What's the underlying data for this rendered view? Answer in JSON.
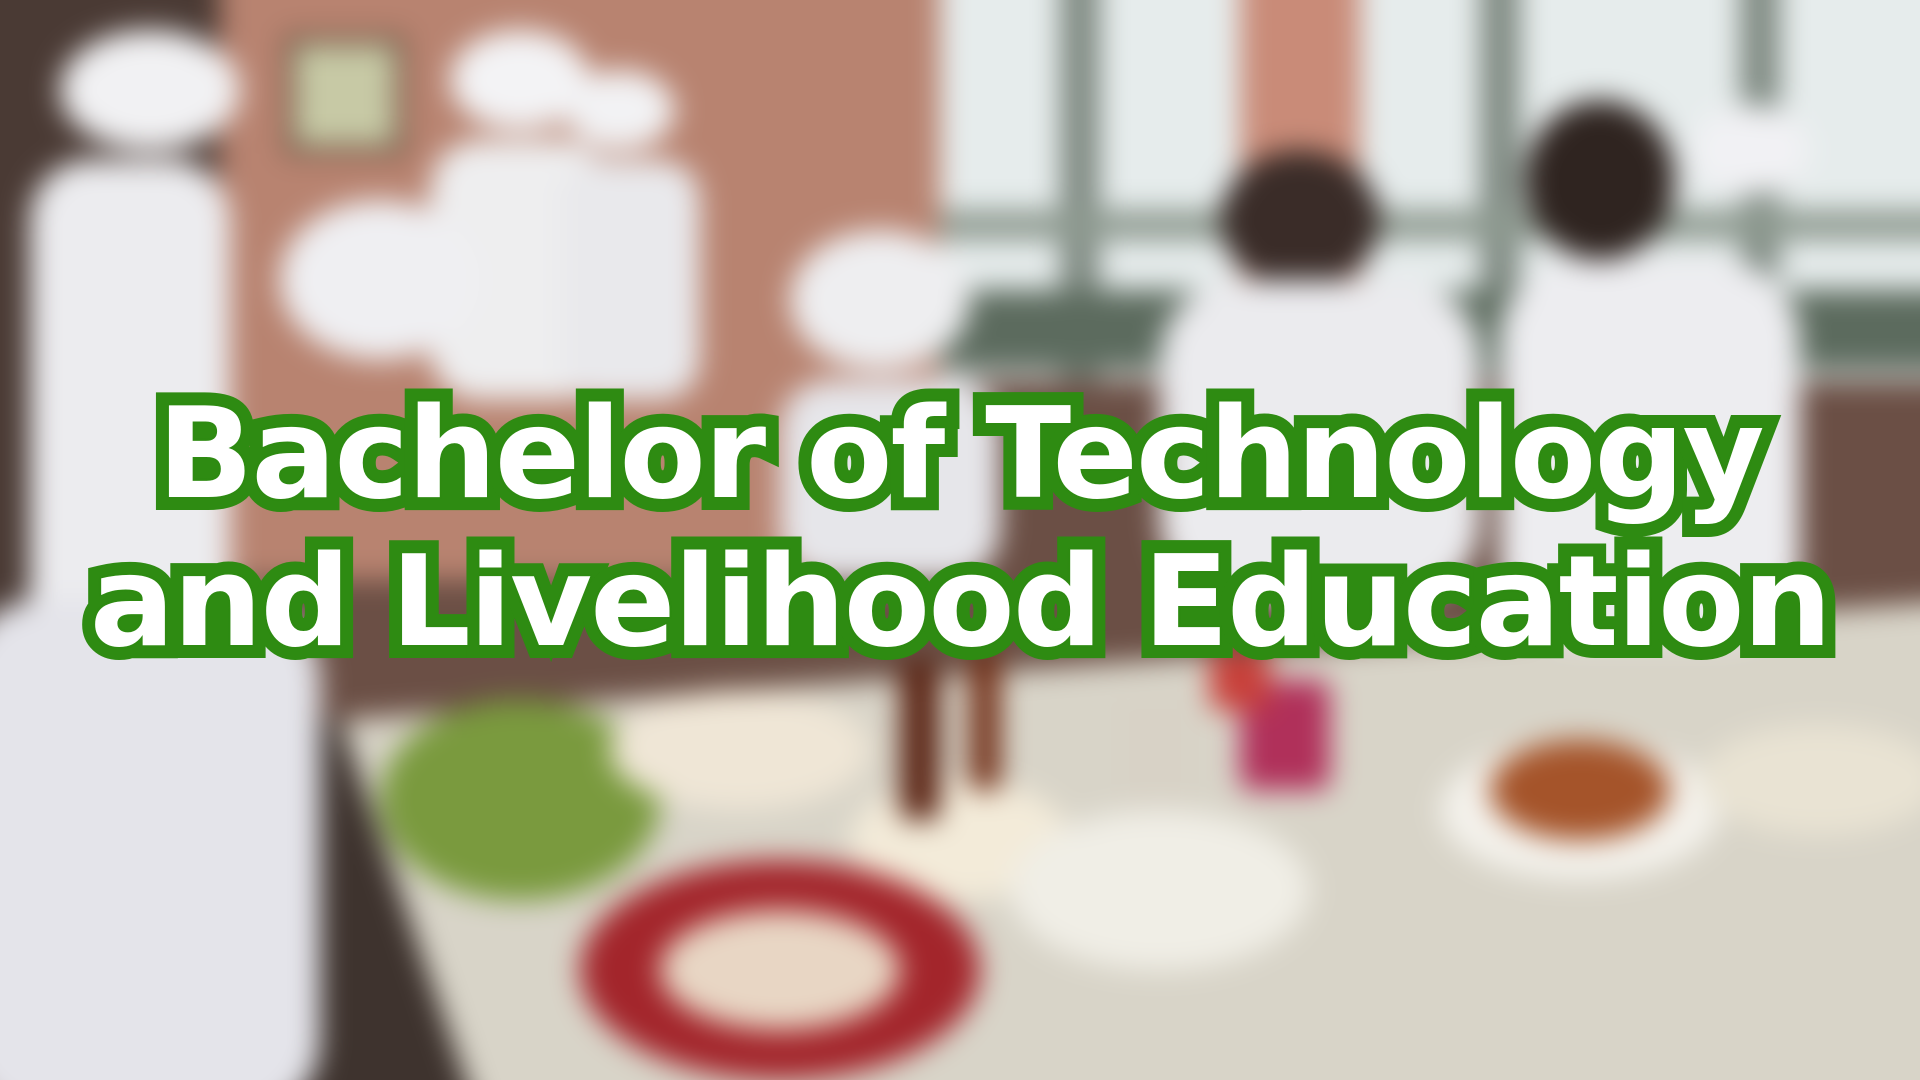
{
  "title": {
    "line1": "Bachelor of Technology",
    "line2": "and Livelihood Education"
  },
  "colors": {
    "text": "#ffffff",
    "outline": "#2e8b12"
  }
}
